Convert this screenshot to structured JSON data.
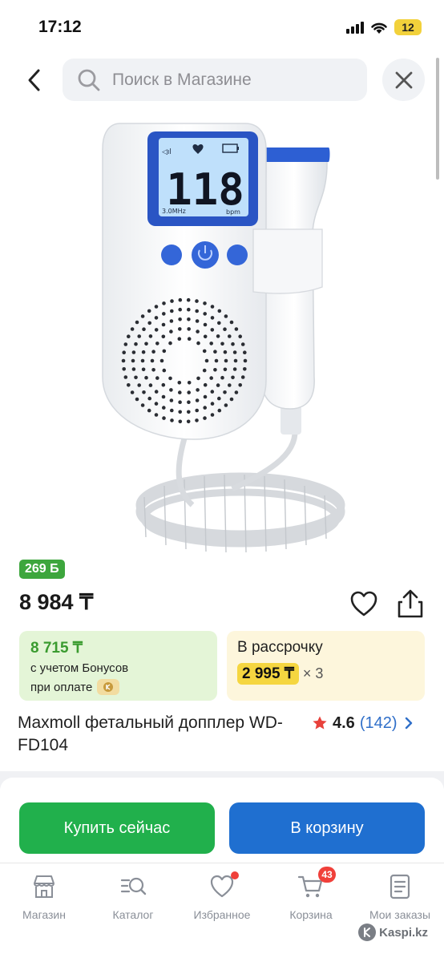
{
  "status": {
    "time": "17:12",
    "battery": "12"
  },
  "search": {
    "placeholder": "Поиск в Магазине"
  },
  "product_image": {
    "display_number": "118",
    "freq_label": "3.0MHz",
    "unit_label": "bpm"
  },
  "product": {
    "bonus_badge": "269 Б",
    "price": "8 984 ₸",
    "title": "Maxmoll фетальный допплер WD-FD104",
    "rating": "4.6",
    "reviews": "(142)"
  },
  "bonus_card": {
    "price": "8 715 ₸",
    "line1": "с учетом Бонусов",
    "line2": "при оплате"
  },
  "installment": {
    "title": "В рассрочку",
    "price": "2 995 ₸",
    "months": "× 3"
  },
  "actions": {
    "buy": "Купить сейчас",
    "cart": "В корзину"
  },
  "tabbar": {
    "items": [
      {
        "label": "Магазин",
        "icon": "shop-icon"
      },
      {
        "label": "Каталог",
        "icon": "catalog-search-icon"
      },
      {
        "label": "Избранное",
        "icon": "heart-icon"
      },
      {
        "label": "Корзина",
        "icon": "cart-icon",
        "badge": "43"
      },
      {
        "label": "Мои заказы",
        "icon": "orders-icon"
      }
    ]
  },
  "watermark": "Kaspi.kz",
  "colors": {
    "green": "#21b04c",
    "blue": "#1f6fd0",
    "bonus_green": "#3da63d",
    "install_yellow": "#f5d640",
    "link_blue": "#2f6fc9",
    "star_red": "#e8413b"
  }
}
